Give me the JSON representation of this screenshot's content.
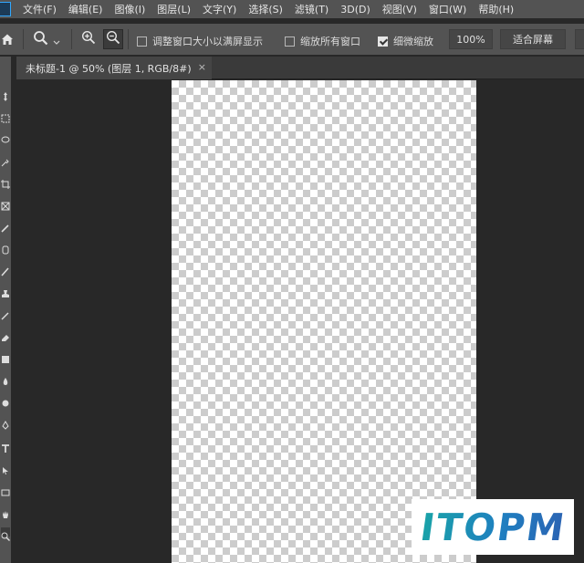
{
  "menubar": {
    "items": [
      "文件(F)",
      "编辑(E)",
      "图像(I)",
      "图层(L)",
      "文字(Y)",
      "选择(S)",
      "滤镜(T)",
      "3D(D)",
      "视图(V)",
      "窗口(W)",
      "帮助(H)"
    ]
  },
  "options": {
    "resize_windows_label": "调整窗口大小以满屏显示",
    "resize_windows_checked": false,
    "zoom_all_label": "缩放所有窗口",
    "zoom_all_checked": false,
    "scrubby_zoom_label": "细微缩放",
    "scrubby_zoom_checked": true,
    "zoom_percent": "100%",
    "fit_screen_label": "适合屏幕"
  },
  "document": {
    "tab_label": "未标题-1 @ 50% (图层 1, RGB/8#)",
    "close_glyph": "×"
  },
  "watermark": {
    "text": "ITOPM"
  },
  "colors": {
    "panel": "#535353",
    "workspace": "#282828",
    "accent": "#31a8ff"
  }
}
